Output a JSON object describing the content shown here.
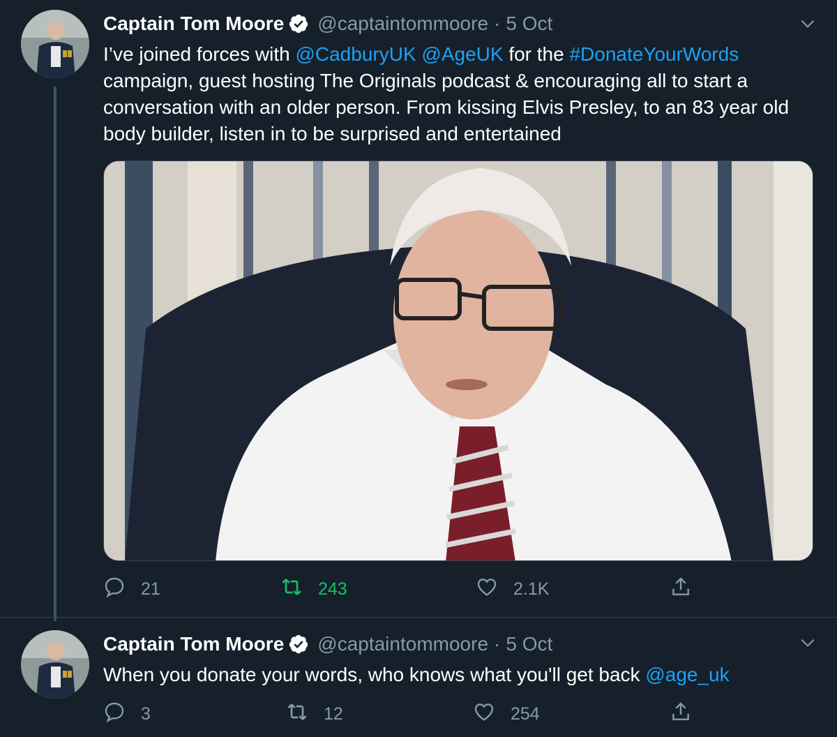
{
  "colors": {
    "background": "#15202b",
    "link": "#1da1f2",
    "muted": "#8899a6",
    "retweet_active": "#17bf63",
    "verified": "#ffffff"
  },
  "tweets": [
    {
      "author_name": "Captain Tom Moore",
      "handle": "@captaintommoore",
      "separator": "·",
      "time": "5 Oct",
      "verified_icon": "verified-badge-icon",
      "text": {
        "t1": "I’ve joined forces with ",
        "m1": "@CadburyUK",
        "t2": " ",
        "m2": "@AgeUK",
        "t3": " for the ",
        "h1": "#DonateYourWords",
        "t4": " campaign, guest hosting The Originals podcast & encouraging all to start a conversation with an older person. From kissing Elvis Presley, to an 83 year old body builder, listen in to be surprised and entertained"
      },
      "media": "photo",
      "replies": "21",
      "retweets": "243",
      "retweeted": true,
      "likes": "2.1K"
    },
    {
      "author_name": "Captain Tom Moore",
      "handle": "@captaintommoore",
      "separator": "·",
      "time": "5 Oct",
      "verified_icon": "verified-badge-icon",
      "text": {
        "t1": "When you donate your words, who knows what you'll get back ",
        "m1": "@age_uk"
      },
      "replies": "3",
      "retweets": "12",
      "retweeted": false,
      "likes": "254"
    }
  ],
  "icons": {
    "reply": "reply-icon",
    "retweet": "retweet-icon",
    "like": "heart-icon",
    "share": "share-icon",
    "more": "chevron-down-icon"
  }
}
